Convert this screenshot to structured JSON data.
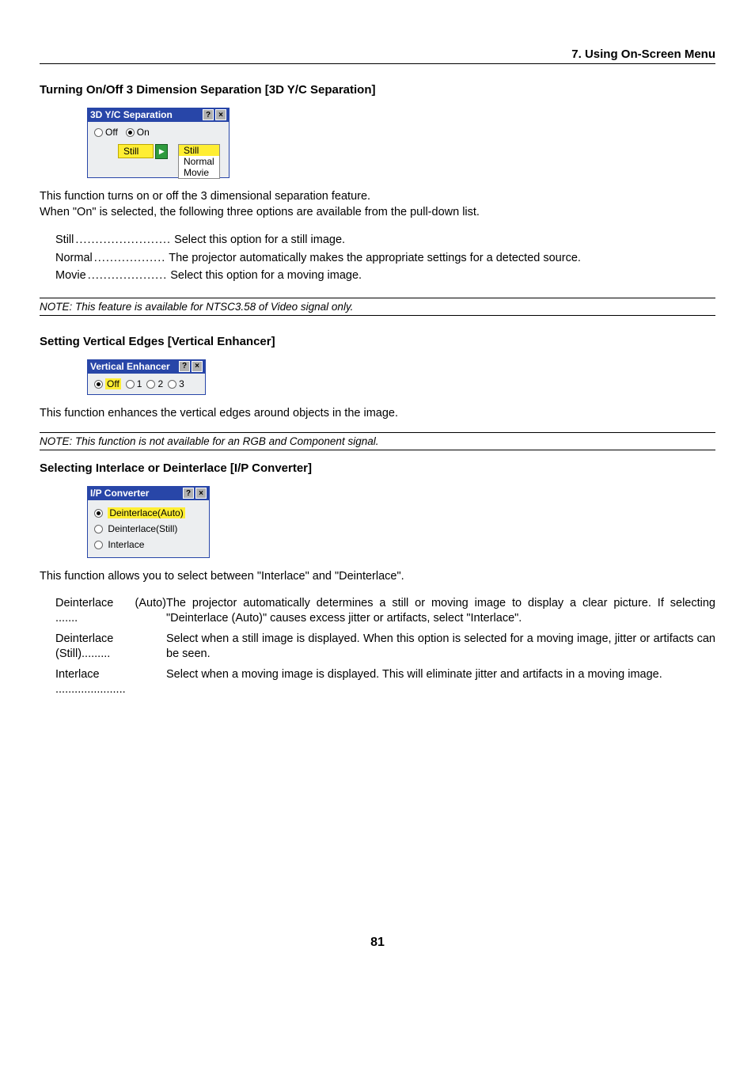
{
  "chapter": {
    "num": "7.",
    "title": "Using On-Screen Menu"
  },
  "sec1": {
    "heading": "Turning On/Off 3 Dimension Separation [3D Y/C Separation]",
    "ui": {
      "title": "3D Y/C Separation",
      "radios": {
        "off": "Off",
        "on": "On"
      },
      "combo_sel": "Still",
      "combo_opts": [
        "Still",
        "Normal",
        "Movie"
      ]
    },
    "body1": "This function turns on or off the 3 dimensional separation feature.",
    "body2": "When \"On\" is selected, the following three options are available from the pull-down list.",
    "opts": {
      "still": {
        "label": "Still",
        "dots": "........................",
        "desc": "Select this option for a still image."
      },
      "normal": {
        "label": "Normal",
        "dots": "..................",
        "desc": "The projector automatically makes the appropriate settings for a detected source."
      },
      "movie": {
        "label": "Movie",
        "dots": "....................",
        "desc": "Select this option for a moving image."
      }
    },
    "note": "NOTE: This feature is available for NTSC3.58 of Video signal only."
  },
  "sec2": {
    "heading": "Setting Vertical Edges [Vertical Enhancer]",
    "ui": {
      "title": "Vertical Enhancer",
      "opts": [
        "Off",
        "1",
        "2",
        "3"
      ]
    },
    "body1": "This function enhances the vertical edges around objects in the image.",
    "note": "NOTE: This function is not available for an RGB and Component signal."
  },
  "sec3": {
    "heading": "Selecting Interlace or Deinterlace [I/P Converter]",
    "ui": {
      "title": "I/P Converter",
      "opts": [
        "Deinterlace(Auto)",
        "Deinterlace(Still)",
        "Interlace"
      ]
    },
    "body1": "This function allows you to select between \"Interlace\" and \"Deinterlace\".",
    "defs": {
      "auto": {
        "label": "Deinterlace (Auto)",
        "dots": ".......",
        "text": "The projector automatically determines a still or moving image to display a clear picture. If selecting \"Deinterlace (Auto)\" causes excess jitter or artifacts, select \"Interlace\"."
      },
      "still": {
        "label": "Deinterlace (Still)",
        "dots": ".........",
        "text": "Select when a still image is displayed. When this option is selected for a moving image, jitter or artifacts can be seen."
      },
      "inter": {
        "label": "Interlace",
        "dots": "......................",
        "text": "Select when a moving image is displayed. This will eliminate jitter and artifacts in a moving image."
      }
    }
  },
  "page_num": "81"
}
